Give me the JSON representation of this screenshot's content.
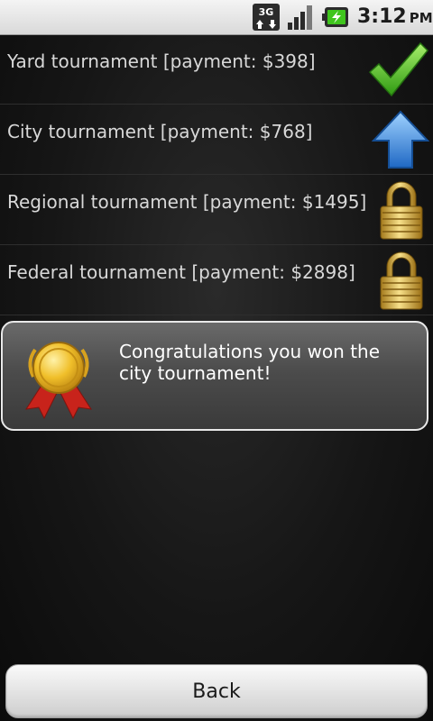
{
  "status_bar": {
    "network_label": "3G",
    "time": "3:12",
    "ampm": "PM",
    "icons": [
      "network-3g-icon",
      "signal-strength-icon",
      "battery-charging-icon"
    ]
  },
  "tournaments": [
    {
      "label": "Yard tournament [payment: $398]",
      "status": "completed",
      "icon": "checkmark-icon"
    },
    {
      "label": "City tournament [payment: $768]",
      "status": "available",
      "icon": "up-arrow-icon"
    },
    {
      "label": "Regional tournament [payment: $1495]",
      "status": "locked",
      "icon": "padlock-icon"
    },
    {
      "label": "Federal tournament [payment: $2898]",
      "status": "locked",
      "icon": "padlock-icon"
    }
  ],
  "congrats": {
    "message": "Congratulations you won the city tournament!",
    "icon": "gold-medal-icon"
  },
  "back_button": {
    "label": "Back"
  },
  "colors": {
    "checkmark": "#3fbf1d",
    "arrow": "#2f7fd6",
    "padlock": "#d9b13a",
    "medal_gold": "#e8b520",
    "ribbon_red": "#c8231b"
  }
}
